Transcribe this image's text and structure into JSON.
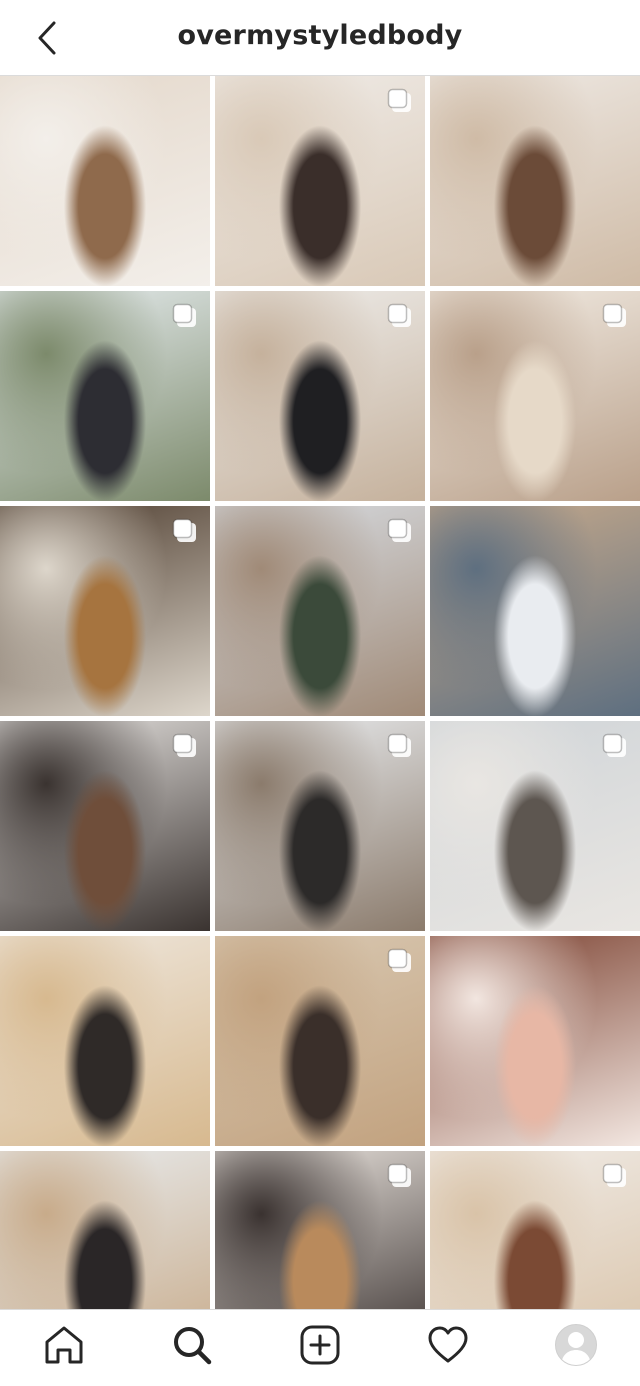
{
  "header": {
    "username": "overmystyledbody",
    "back_icon": "chevron-left-icon"
  },
  "colors": {
    "text": "#262626",
    "divider": "#dbdbdb",
    "background": "#ffffff"
  },
  "grid": {
    "posts": [
      {
        "id": 1,
        "multiple": false,
        "palette": [
          "#9aa3ad",
          "#dcdfe3",
          "#5b6f8e"
        ]
      },
      {
        "id": 2,
        "multiple": false,
        "palette": [
          "#b57a45",
          "#f1efec",
          "#2a2a2e"
        ]
      },
      {
        "id": 3,
        "multiple": false,
        "palette": [
          "#c9cbcf",
          "#8c8f95",
          "#e8d7c5"
        ]
      },
      {
        "id": 4,
        "multiple": true,
        "palette": [
          "#e8eef1",
          "#2d2d33",
          "#7c8a6b"
        ]
      },
      {
        "id": 5,
        "multiple": true,
        "palette": [
          "#efeeec",
          "#1f1f22",
          "#c5b19c"
        ]
      },
      {
        "id": 6,
        "multiple": true,
        "palette": [
          "#f3ede5",
          "#e6d9c8",
          "#b9a08a"
        ]
      },
      {
        "id": 7,
        "multiple": true,
        "palette": [
          "#4b3a2c",
          "#a6743f",
          "#ddd6cb"
        ]
      },
      {
        "id": 8,
        "multiple": true,
        "palette": [
          "#d8dde3",
          "#3b4a3a",
          "#a08a77"
        ]
      },
      {
        "id": 9,
        "multiple": false,
        "palette": [
          "#c9ab8c",
          "#e9ecf0",
          "#5e6f80"
        ]
      },
      {
        "id": 10,
        "multiple": true,
        "palette": [
          "#e9e6e3",
          "#6f4e3a",
          "#3a3330"
        ]
      },
      {
        "id": 11,
        "multiple": true,
        "palette": [
          "#ebeef1",
          "#2c2a29",
          "#8b7b6c"
        ]
      },
      {
        "id": 12,
        "multiple": true,
        "palette": [
          "#cfd4d8",
          "#5d5650",
          "#e9e6e2"
        ]
      },
      {
        "id": 13,
        "multiple": false,
        "palette": [
          "#efe8df",
          "#2f2a28",
          "#d7b98f"
        ]
      },
      {
        "id": 14,
        "multiple": true,
        "palette": [
          "#d9c9b3",
          "#3a2f2a",
          "#c2a27f"
        ]
      },
      {
        "id": 15,
        "multiple": false,
        "palette": [
          "#7a3f2e",
          "#e7b7a5",
          "#f2e6e0"
        ]
      },
      {
        "id": 16,
        "multiple": false,
        "palette": [
          "#e9edf0",
          "#2a2627",
          "#c8ab8a"
        ]
      },
      {
        "id": 17,
        "multiple": true,
        "palette": [
          "#efe9e3",
          "#b98a5c",
          "#3a3230"
        ]
      },
      {
        "id": 18,
        "multiple": true,
        "palette": [
          "#f1ede9",
          "#7b4a34",
          "#d9c3a8"
        ]
      },
      {
        "id": 19,
        "multiple": false,
        "palette": [
          "#e4d8cb",
          "#8f6a4c",
          "#f3efea"
        ]
      },
      {
        "id": 20,
        "multiple": true,
        "palette": [
          "#f0ece8",
          "#3a2e2a",
          "#d9c9b7"
        ]
      },
      {
        "id": 21,
        "multiple": false,
        "palette": [
          "#efeae5",
          "#6b4b38",
          "#cfbba6"
        ]
      }
    ]
  },
  "tabbar": {
    "items": [
      {
        "name": "home",
        "icon": "home-icon",
        "active": false
      },
      {
        "name": "search",
        "icon": "search-icon",
        "active": true
      },
      {
        "name": "new-post",
        "icon": "plus-square-icon",
        "active": false
      },
      {
        "name": "activity",
        "icon": "heart-icon",
        "active": false
      },
      {
        "name": "profile",
        "icon": "avatar",
        "active": false
      }
    ]
  }
}
